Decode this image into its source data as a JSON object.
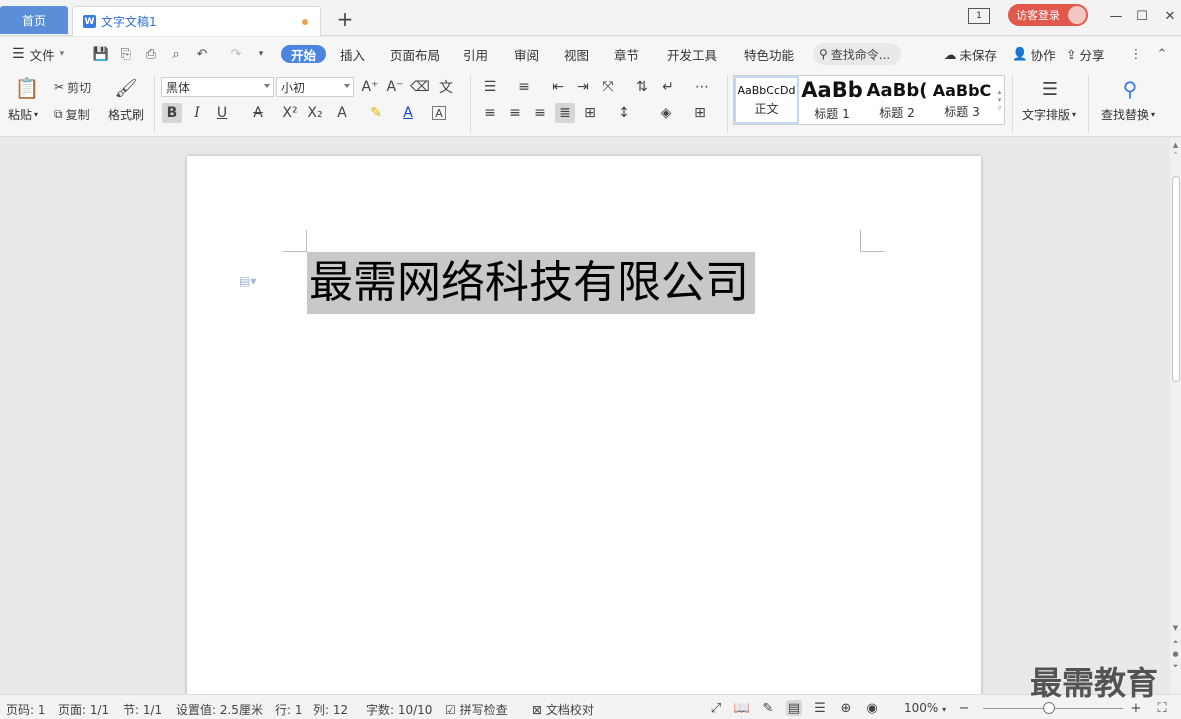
{
  "tabs": {
    "home_label": "首页",
    "doc_label": "文字文稿1",
    "doc_icon_letter": "W",
    "add_symbol": "+"
  },
  "window": {
    "layout_badge": "1",
    "login_label": "访客登录",
    "minimize": "—",
    "maximize": "☐",
    "close": "✕"
  },
  "menubar": {
    "file_label": "文件",
    "items": [
      "开始",
      "插入",
      "页面布局",
      "引用",
      "审阅",
      "视图",
      "章节",
      "开发工具",
      "特色功能"
    ],
    "search_placeholder": "查找命令...",
    "unsaved_label": "未保存",
    "collab_label": "协作",
    "share_label": "分享"
  },
  "ribbon": {
    "paste_label": "粘贴",
    "cut_label": "剪切",
    "copy_label": "复制",
    "format_painter_label": "格式刷",
    "font_name": "黑体",
    "font_size": "小初",
    "bold": "B",
    "italic": "I",
    "underline": "U",
    "styles": [
      {
        "preview": "AaBbCcDd",
        "name": "正文"
      },
      {
        "preview": "AaBb",
        "name": "标题 1"
      },
      {
        "preview": "AaBb(",
        "name": "标题 2"
      },
      {
        "preview": "AaBbC",
        "name": "标题 3"
      }
    ],
    "text_layout_label": "文字排版",
    "find_replace_label": "查找替换"
  },
  "document": {
    "selected_text": "最需网络科技有限公司"
  },
  "statusbar": {
    "page_num": "页码: 1",
    "pages": "页面: 1/1",
    "section": "节: 1/1",
    "setting": "设置值: 2.5厘米",
    "row": "行: 1",
    "col": "列: 12",
    "word_count": "字数: 10/10",
    "spell_check": "拼写检查",
    "doc_review": "文档校对",
    "zoom": "100%"
  },
  "watermark": "最需教育"
}
